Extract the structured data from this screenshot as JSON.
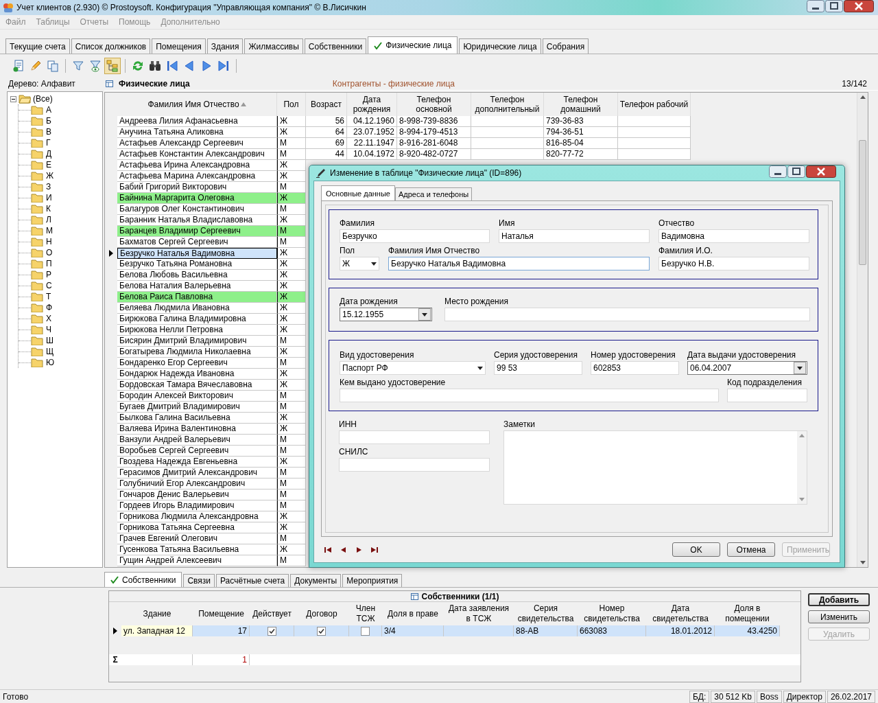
{
  "window": {
    "title": "Учет клиентов (2.930) © Prostoysoft. Конфигурация \"Управляющая компания\" © В.Лисичкин"
  },
  "menu": [
    "Файл",
    "Таблицы",
    "Отчеты",
    "Помощь",
    "Дополнительно"
  ],
  "tabs": [
    {
      "label": "Текущие счета",
      "selected": false
    },
    {
      "label": "Список должников",
      "selected": false
    },
    {
      "label": "Помещения",
      "selected": false
    },
    {
      "label": "Здания",
      "selected": false
    },
    {
      "label": "Жилмассивы",
      "selected": false
    },
    {
      "label": "Собственники",
      "selected": false
    },
    {
      "label": "Физические лица",
      "selected": true
    },
    {
      "label": "Юридические лица",
      "selected": false
    },
    {
      "label": "Собрания",
      "selected": false
    }
  ],
  "tree": {
    "title": "Дерево: Алфавит",
    "root": {
      "label": "(Все)",
      "expanded": true,
      "children": [
        {
          "label": "А"
        },
        {
          "label": "Б"
        },
        {
          "label": "В"
        },
        {
          "label": "Г"
        },
        {
          "label": "Д"
        },
        {
          "label": "Е"
        },
        {
          "label": "Ж"
        },
        {
          "label": "З"
        },
        {
          "label": "И"
        },
        {
          "label": "К"
        },
        {
          "label": "Л"
        },
        {
          "label": "М"
        },
        {
          "label": "Н"
        },
        {
          "label": "О"
        },
        {
          "label": "П"
        },
        {
          "label": "Р"
        },
        {
          "label": "С"
        },
        {
          "label": "Т"
        },
        {
          "label": "Ф"
        },
        {
          "label": "Х"
        },
        {
          "label": "Ч"
        },
        {
          "label": "Ш"
        },
        {
          "label": "Щ"
        },
        {
          "label": "Ю"
        }
      ]
    }
  },
  "grid": {
    "title": "Физические лица",
    "subtitle": "Контрагенты - физические лица",
    "counter": "13/142",
    "columns": [
      {
        "label": "Фамилия Имя Отчество",
        "sorted": true
      },
      {
        "label": "Пол",
        "sorted": false
      },
      {
        "label": "Возраст",
        "sorted": false
      },
      {
        "label": "Дата\nрождения",
        "sorted": false
      },
      {
        "label": "Телефон\nосновной",
        "sorted": false
      },
      {
        "label": "Телефон\nдополнительный",
        "sorted": false
      },
      {
        "label": "Телефон\nдомашний",
        "sorted": false
      },
      {
        "label": "Телефон рабочий",
        "sorted": false
      }
    ],
    "rows": [
      {
        "name": "Андреева Лилия Афанасьевна",
        "gender": "Ж",
        "age": "56",
        "birth_date": "04.12.1960",
        "phone_main": "8-998-739-8836",
        "phone_home": "739-36-83",
        "highlighted": false,
        "selected": false
      },
      {
        "name": "Анучина Татьяна Аликовна",
        "gender": "Ж",
        "age": "64",
        "birth_date": "23.07.1952",
        "phone_main": "8-994-179-4513",
        "phone_home": "794-36-51",
        "highlighted": false,
        "selected": false
      },
      {
        "name": "Астафьев Александр Сергеевич",
        "gender": "М",
        "age": "69",
        "birth_date": "22.11.1947",
        "phone_main": "8-916-281-6048",
        "phone_home": "816-85-04",
        "highlighted": false,
        "selected": false
      },
      {
        "name": "Астафьев Константин Александрович",
        "gender": "М",
        "age": "44",
        "birth_date": "10.04.1972",
        "phone_main": "8-920-482-0727",
        "phone_home": "820-77-72",
        "highlighted": false,
        "selected": false
      },
      {
        "name": "Астафьева Ирина Александровна",
        "gender": "Ж",
        "highlighted": false,
        "selected": false
      },
      {
        "name": "Астафьева Марина Александровна",
        "gender": "Ж",
        "highlighted": false,
        "selected": false
      },
      {
        "name": "Бабий Григорий Викторович",
        "gender": "М",
        "highlighted": false,
        "selected": false
      },
      {
        "name": "Байнина Маргарита Олеговна",
        "gender": "Ж",
        "highlighted": true,
        "selected": false
      },
      {
        "name": "Балагуров Олег Константинович",
        "gender": "М",
        "highlighted": false,
        "selected": false
      },
      {
        "name": "Баранник Наталья Владиславовна",
        "gender": "Ж",
        "highlighted": false,
        "selected": false
      },
      {
        "name": "Баранцев Владимир Сергеевич",
        "gender": "М",
        "highlighted": true,
        "selected": false
      },
      {
        "name": "Бахматов Сергей Сергеевич",
        "gender": "М",
        "highlighted": false,
        "selected": false
      },
      {
        "name": "Безручко Наталья Вадимовна",
        "gender": "Ж",
        "highlighted": false,
        "selected": true
      },
      {
        "name": "Безручко Татьяна Романовна",
        "gender": "Ж",
        "highlighted": false,
        "selected": false
      },
      {
        "name": "Белова Любовь Васильевна",
        "gender": "Ж",
        "highlighted": false,
        "selected": false
      },
      {
        "name": "Белова Наталия Валерьевна",
        "gender": "Ж",
        "highlighted": false,
        "selected": false
      },
      {
        "name": "Белова Раиса Павловна",
        "gender": "Ж",
        "highlighted": true,
        "selected": false
      },
      {
        "name": "Беляева Людмила Ивановна",
        "gender": "Ж",
        "highlighted": false,
        "selected": false
      },
      {
        "name": "Бирюкова Галина Владимировна",
        "gender": "Ж",
        "highlighted": false,
        "selected": false
      },
      {
        "name": "Бирюкова Нелли Петровна",
        "gender": "Ж",
        "highlighted": false,
        "selected": false
      },
      {
        "name": "Бисярин Дмитрий Владимирович",
        "gender": "М",
        "highlighted": false,
        "selected": false
      },
      {
        "name": "Богатырева Людмила Николаевна",
        "gender": "Ж",
        "highlighted": false,
        "selected": false
      },
      {
        "name": "Бондаренко Егор Сергеевич",
        "gender": "М",
        "highlighted": false,
        "selected": false
      },
      {
        "name": "Бондарюк Надежда Ивановна",
        "gender": "Ж",
        "highlighted": false,
        "selected": false
      },
      {
        "name": "Бордовская Тамара Вячеславовна",
        "gender": "Ж",
        "highlighted": false,
        "selected": false
      },
      {
        "name": "Бородин Алексей Викторович",
        "gender": "М",
        "highlighted": false,
        "selected": false
      },
      {
        "name": "Бугаев Дмитрий Владимирович",
        "gender": "М",
        "highlighted": false,
        "selected": false
      },
      {
        "name": "Былкова Галина Васильевна",
        "gender": "Ж",
        "highlighted": false,
        "selected": false
      },
      {
        "name": "Валяева Ирина Валентиновна",
        "gender": "Ж",
        "highlighted": false,
        "selected": false
      },
      {
        "name": "Ванзули Андрей Валерьевич",
        "gender": "М",
        "highlighted": false,
        "selected": false
      },
      {
        "name": "Воробьев Сергей Сергеевич",
        "gender": "М",
        "highlighted": false,
        "selected": false
      },
      {
        "name": "Гвоздева Надежда Евгеньевна",
        "gender": "Ж",
        "highlighted": false,
        "selected": false
      },
      {
        "name": "Герасимов Дмитрий Александрович",
        "gender": "М",
        "highlighted": false,
        "selected": false
      },
      {
        "name": "Голубничий Егор Александрович",
        "gender": "М",
        "highlighted": false,
        "selected": false
      },
      {
        "name": "Гончаров Денис Валерьевич",
        "gender": "М",
        "highlighted": false,
        "selected": false
      },
      {
        "name": "Гордеев Игорь Владимирович",
        "gender": "М",
        "highlighted": false,
        "selected": false
      },
      {
        "name": "Горникова Людмила Александровна",
        "gender": "Ж",
        "highlighted": false,
        "selected": false
      },
      {
        "name": "Горникова Татьяна Сергеевна",
        "gender": "Ж",
        "highlighted": false,
        "selected": false
      },
      {
        "name": "Грачев Евгений Олегович",
        "gender": "М",
        "highlighted": false,
        "selected": false
      },
      {
        "name": "Гусенкова Татьяна Васильевна",
        "gender": "Ж",
        "highlighted": false,
        "selected": false
      },
      {
        "name": "Гущин Андрей Алексеевич",
        "gender": "М",
        "highlighted": false,
        "selected": false
      }
    ]
  },
  "dialog": {
    "title": "Изменение в таблице \"Физические лица\" (ID=896)",
    "tabs": [
      {
        "label": "Основные данные",
        "selected": true
      },
      {
        "label": "Адреса и телефоны",
        "selected": false
      }
    ],
    "groups": [
      {
        "boxed": true,
        "fields": [
          {
            "label": "Фамилия",
            "kind": "text",
            "value": "Безручко"
          },
          {
            "label": "Имя",
            "kind": "text",
            "value": "Наталья"
          },
          {
            "label": "Отчество",
            "kind": "text",
            "value": "Вадимовна"
          },
          {
            "label": "Пол",
            "kind": "select",
            "value": "Ж"
          },
          {
            "label": "Фамилия Имя Отчество",
            "kind": "text",
            "value": "Безручко Наталья Вадимовна"
          },
          {
            "label": "Фамилия И.О.",
            "kind": "text",
            "value": "Безручко Н.В."
          }
        ]
      },
      {
        "boxed": true,
        "fields": [
          {
            "label": "Дата рождения",
            "kind": "date",
            "value": "15.12.1955"
          },
          {
            "label": "Место рождения",
            "kind": "text"
          }
        ]
      },
      {
        "boxed": true,
        "fields": [
          {
            "label": "Вид удостоверения",
            "kind": "select",
            "value": "Паспорт РФ"
          },
          {
            "label": "Серия удостоверения",
            "kind": "text",
            "value": "99 53"
          },
          {
            "label": "Номер удостоверения",
            "kind": "text",
            "value": "602853"
          },
          {
            "label": "Дата выдачи удостоверения",
            "kind": "date",
            "value": "06.04.2007"
          },
          {
            "label": "Кем выдано удостоверение",
            "kind": "text"
          },
          {
            "label": "Код подразделения",
            "kind": "text"
          }
        ]
      },
      {
        "boxed": false,
        "fields": [
          {
            "label": "ИНН",
            "kind": "text"
          },
          {
            "label": "СНИЛС",
            "kind": "text"
          },
          {
            "label": "Заметки",
            "kind": "textarea"
          }
        ]
      }
    ],
    "buttons": [
      {
        "label": "OK",
        "disabled": false
      },
      {
        "label": "Отмена",
        "disabled": false
      },
      {
        "label": "Применить",
        "disabled": true
      }
    ]
  },
  "bottom": {
    "tabs": [
      {
        "label": "Собственники",
        "selected": true
      },
      {
        "label": "Связи",
        "selected": false
      },
      {
        "label": "Расчётные счета",
        "selected": false
      },
      {
        "label": "Документы",
        "selected": false
      },
      {
        "label": "Мероприятия",
        "selected": false
      }
    ],
    "grid": {
      "title": "Собственники (1/1)",
      "columns": [
        "Здание",
        "Помещение",
        "Действует",
        "Договор",
        "Член\nТСЖ",
        "Доля в праве",
        "Дата заявления\nв ТСЖ",
        "Серия\nсвидетельства",
        "Номер\nсвидетельства",
        "Дата\nсвидетельства",
        "Доля в\nпомещении"
      ],
      "rows": [
        {
          "building": "ул. Западная 12",
          "room": "17",
          "active": true,
          "contract": true,
          "member": false,
          "share": "3/4",
          "cert_series": "88-АВ",
          "cert_number": "663083",
          "cert_date": "18.01.2012",
          "room_share": "43.4250",
          "selected": true
        }
      ],
      "total_sign": "Σ",
      "totals": {
        "room": "1"
      }
    },
    "buttons": [
      {
        "label": "Добавить",
        "default": true,
        "disabled": false
      },
      {
        "label": "Изменить",
        "default": false,
        "disabled": false
      },
      {
        "label": "Удалить",
        "default": false,
        "disabled": true
      }
    ]
  },
  "status_bar": {
    "message": "Готово",
    "panels": [
      "БД:",
      "30 512 Kb",
      "Boss",
      "Директор",
      "26.02.2017"
    ]
  }
}
